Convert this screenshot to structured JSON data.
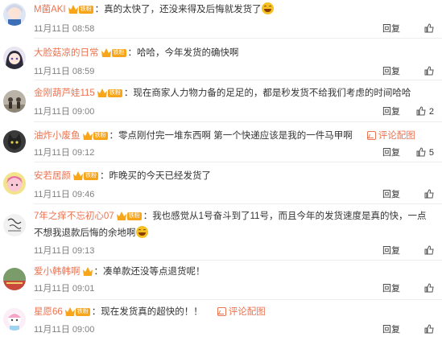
{
  "comments": [
    {
      "username": "M菌AKI",
      "badge": "铁粉",
      "text": "真的太快了，还没来得及后悔就发货了",
      "emoji": true,
      "time": "11月11日 08:58",
      "reply": "回复",
      "likes": "",
      "review": ""
    },
    {
      "username": "大脸菇凉的日常",
      "badge": "铁粉",
      "text": "哈哈，今年发货的确快啊",
      "emoji": false,
      "time": "11月11日 08:59",
      "reply": "回复",
      "likes": "",
      "review": ""
    },
    {
      "username": "金刚葫芦娃115",
      "badge": "铁粉",
      "text": "现在商家人力物力备的足足的，都是秒发货不给我们考虑的时间哈哈",
      "emoji": false,
      "time": "11月11日 09:00",
      "reply": "回复",
      "likes": "2",
      "review": ""
    },
    {
      "username": "油炸小废鱼",
      "badge": "铁粉",
      "text": "零点刚付完一堆东西啊 第一个快递应该是我的一件马甲啊",
      "emoji": false,
      "time": "11月11日 09:12",
      "reply": "回复",
      "likes": "5",
      "review": "评论配图"
    },
    {
      "username": "安若居颜",
      "badge": "铁粉",
      "text": "昨晚买的今天已经发货了",
      "emoji": false,
      "time": "11月11日 09:46",
      "reply": "回复",
      "likes": "",
      "review": ""
    },
    {
      "username": "7年之痒不忘初心07",
      "badge": "铁粉",
      "text": "我也感觉从1号奋斗到了11号，而且今年的发货速度是真的快，一点不想我退款后悔的余地啊",
      "emoji": true,
      "time": "11月11日 09:13",
      "reply": "回复",
      "likes": "",
      "review": ""
    },
    {
      "username": "爱小韩韩啊",
      "badge": "",
      "text": "凑单款还没等点退货呢！",
      "emoji": false,
      "time": "11月11日 09:01",
      "reply": "回复",
      "likes": "",
      "review": ""
    },
    {
      "username": "星愿66",
      "badge": "铁粉",
      "text": "现在发货真的超快的！！",
      "emoji": false,
      "time": "11月11日 09:00",
      "reply": "回复",
      "likes": "",
      "review": "评论配图"
    }
  ],
  "colors": {
    "username": "#eb7350",
    "badge": "#f7a51a",
    "meta": "#808080",
    "text": "#333333"
  },
  "icons": {
    "like": "thumbs-up-icon",
    "badge": "crown-icon",
    "review": "picture-icon",
    "emoji": "laughing-emoji"
  }
}
